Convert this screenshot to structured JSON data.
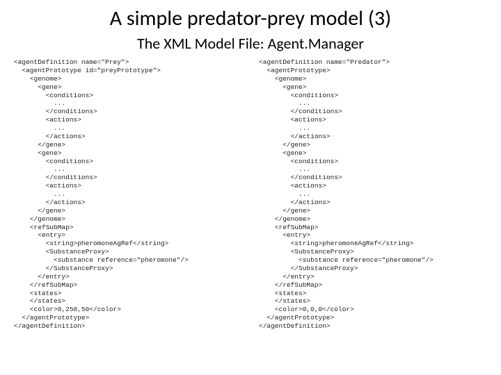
{
  "title": "A simple predator-prey model (3)",
  "subtitle": "The XML Model File: Agent.Manager",
  "left_code": "<agentDefinition name=\"Prey\">\n  <agentPrototype id=\"preyPrototype\">\n    <genome>\n      <gene>\n        <conditions>\n          ...\n        </conditions>\n        <actions>\n          ...\n        </actions>\n      </gene>\n      <gene>\n        <conditions>\n          ...\n        </conditions>\n        <actions>\n          ...\n        </actions>\n      </gene>\n    </genome>\n    <refSubMap>\n      <entry>\n        <string>pheromoneAgRef</string>\n        <SubstanceProxy>\n          <substance reference=\"pheromone\"/>\n        </SubstanceProxy>\n      </entry>\n    </refSubMap>\n    <states>\n    </states>\n    <color>0,250,50</color>\n  </agentPrototype>\n</agentDefinition>",
  "right_code": "<agentDefinition name=\"Predator\">\n  <agentPrototype>\n    <genome>\n      <gene>\n        <conditions>\n          ...\n        </conditions>\n        <actions>\n          ...\n        </actions>\n      </gene>\n      <gene>\n        <conditions>\n          ...\n        </conditions>\n        <actions>\n          ...\n        </actions>\n      </gene>\n    </genome>\n    <refSubMap>\n      <entry>\n        <string>pheromoneAgRef</string>\n        <SubstanceProxy>\n          <substance reference=\"pheromone\"/>\n        </SubstanceProxy>\n      </entry>\n    </refSubMap>\n    <states>\n    </states>\n    <color>0,0,0</color>\n  </agentPrototype>\n</agentDefinition>"
}
